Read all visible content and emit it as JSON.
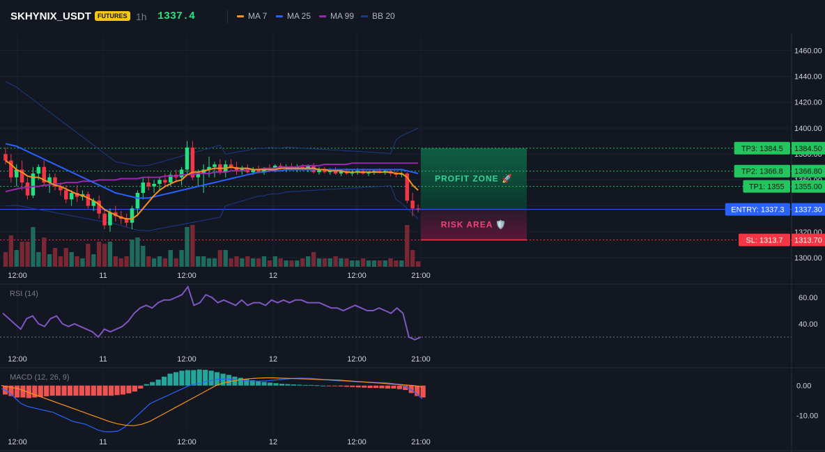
{
  "header": {
    "symbol": "SKHYNIX_USDT",
    "badge": "FUTURES",
    "interval": "1h",
    "price": "1337.4"
  },
  "legend": [
    {
      "label": "MA 7",
      "color": "#f7931a",
      "icon": "line-swatch"
    },
    {
      "label": "MA 25",
      "color": "#2962ff",
      "icon": "line-swatch"
    },
    {
      "label": "MA 99",
      "color": "#9c27b0",
      "icon": "line-swatch"
    },
    {
      "label": "BB 20",
      "color": "#1e3a8a",
      "icon": "line-swatch"
    }
  ],
  "chart_data": {
    "type": "candlestick",
    "symbol": "SKHYNIX_USDT",
    "interval": "1h",
    "price_axis": {
      "ticks": [
        "1460.00",
        "1440.00",
        "1420.00",
        "1400.00",
        "1380.00",
        "1360.00",
        "1340.00",
        "1320.00",
        "1300.00"
      ],
      "min": 1293,
      "max": 1472
    },
    "time_axis": [
      "12:00",
      "11",
      "12:00",
      "12",
      "12:00",
      "21:00"
    ],
    "candles": [
      [
        1380,
        1385,
        1372,
        1375
      ],
      [
        1375,
        1380,
        1358,
        1362
      ],
      [
        1362,
        1372,
        1355,
        1368
      ],
      [
        1368,
        1375,
        1352,
        1358
      ],
      [
        1358,
        1362,
        1345,
        1348
      ],
      [
        1348,
        1370,
        1346,
        1365
      ],
      [
        1365,
        1372,
        1360,
        1370
      ],
      [
        1370,
        1375,
        1355,
        1358
      ],
      [
        1358,
        1365,
        1350,
        1362
      ],
      [
        1362,
        1365,
        1352,
        1355
      ],
      [
        1355,
        1358,
        1348,
        1352
      ],
      [
        1352,
        1356,
        1342,
        1345
      ],
      [
        1345,
        1352,
        1340,
        1350
      ],
      [
        1350,
        1356,
        1343,
        1347
      ],
      [
        1347,
        1352,
        1344,
        1349
      ],
      [
        1349,
        1351,
        1338,
        1340
      ],
      [
        1340,
        1346,
        1336,
        1344
      ],
      [
        1344,
        1348,
        1330,
        1334
      ],
      [
        1334,
        1338,
        1322,
        1325
      ],
      [
        1325,
        1338,
        1320,
        1335
      ],
      [
        1335,
        1340,
        1328,
        1332
      ],
      [
        1332,
        1336,
        1326,
        1330
      ],
      [
        1330,
        1334,
        1324,
        1327
      ],
      [
        1327,
        1340,
        1322,
        1338
      ],
      [
        1338,
        1352,
        1332,
        1350
      ],
      [
        1350,
        1362,
        1345,
        1358
      ],
      [
        1358,
        1363,
        1352,
        1355
      ],
      [
        1355,
        1360,
        1350,
        1357
      ],
      [
        1357,
        1362,
        1352,
        1360
      ],
      [
        1360,
        1365,
        1355,
        1358
      ],
      [
        1358,
        1366,
        1355,
        1364
      ],
      [
        1364,
        1368,
        1358,
        1362
      ],
      [
        1362,
        1370,
        1356,
        1368
      ],
      [
        1368,
        1390,
        1365,
        1385
      ],
      [
        1385,
        1390,
        1360,
        1362
      ],
      [
        1362,
        1368,
        1355,
        1365
      ],
      [
        1365,
        1372,
        1350,
        1368
      ],
      [
        1368,
        1378,
        1362,
        1370
      ],
      [
        1370,
        1374,
        1362,
        1372
      ],
      [
        1372,
        1376,
        1364,
        1366
      ],
      [
        1366,
        1375,
        1362,
        1372
      ],
      [
        1372,
        1376,
        1368,
        1370
      ],
      [
        1370,
        1374,
        1364,
        1367
      ],
      [
        1367,
        1371,
        1364,
        1369
      ],
      [
        1369,
        1372,
        1365,
        1366
      ],
      [
        1366,
        1370,
        1364,
        1368
      ],
      [
        1368,
        1371,
        1365,
        1366
      ],
      [
        1366,
        1370,
        1364,
        1369
      ],
      [
        1369,
        1372,
        1366,
        1368
      ],
      [
        1368,
        1372,
        1366,
        1371
      ],
      [
        1371,
        1373,
        1367,
        1369
      ],
      [
        1369,
        1372,
        1366,
        1370
      ],
      [
        1370,
        1373,
        1367,
        1369
      ],
      [
        1369,
        1372,
        1366,
        1370
      ],
      [
        1370,
        1372,
        1367,
        1368
      ],
      [
        1368,
        1372,
        1366,
        1371
      ],
      [
        1371,
        1373,
        1365,
        1366
      ],
      [
        1366,
        1370,
        1364,
        1368
      ],
      [
        1368,
        1370,
        1365,
        1366
      ],
      [
        1366,
        1369,
        1364,
        1368
      ],
      [
        1368,
        1370,
        1364,
        1365
      ],
      [
        1365,
        1368,
        1363,
        1367
      ],
      [
        1367,
        1369,
        1364,
        1365
      ],
      [
        1365,
        1368,
        1363,
        1366
      ],
      [
        1366,
        1369,
        1364,
        1367
      ],
      [
        1367,
        1369,
        1364,
        1365
      ],
      [
        1365,
        1367,
        1363,
        1366
      ],
      [
        1366,
        1368,
        1364,
        1367
      ],
      [
        1367,
        1369,
        1365,
        1366
      ],
      [
        1366,
        1368,
        1364,
        1367
      ],
      [
        1367,
        1368,
        1363,
        1365
      ],
      [
        1365,
        1367,
        1362,
        1364
      ],
      [
        1364,
        1366,
        1362,
        1365
      ],
      [
        1365,
        1366,
        1342,
        1344
      ],
      [
        1344,
        1350,
        1332,
        1338
      ],
      [
        1338,
        1341,
        1335,
        1337.4
      ]
    ],
    "ma7": [
      1375,
      1372,
      1368,
      1366,
      1363,
      1362,
      1362,
      1360,
      1358,
      1356,
      1355,
      1353,
      1351,
      1349,
      1348,
      1346,
      1344,
      1341,
      1337,
      1335,
      1333,
      1331,
      1330,
      1330,
      1333,
      1338,
      1343,
      1348,
      1352,
      1355,
      1357,
      1359,
      1360,
      1364,
      1366,
      1366,
      1367,
      1368,
      1369,
      1369,
      1369,
      1370,
      1369,
      1369,
      1369,
      1368,
      1368,
      1368,
      1368,
      1368,
      1369,
      1369,
      1369,
      1369,
      1369,
      1369,
      1369,
      1368,
      1368,
      1367,
      1367,
      1367,
      1366,
      1366,
      1366,
      1366,
      1366,
      1366,
      1366,
      1366,
      1366,
      1365,
      1365,
      1362,
      1356,
      1352
    ],
    "ma25": [
      1388,
      1387,
      1386,
      1384,
      1382,
      1380,
      1378,
      1376,
      1374,
      1372,
      1370,
      1368,
      1366,
      1364,
      1362,
      1360,
      1358,
      1356,
      1354,
      1352,
      1350,
      1349,
      1348,
      1347,
      1346,
      1346,
      1346,
      1347,
      1348,
      1349,
      1350,
      1351,
      1352,
      1353,
      1354,
      1355,
      1356,
      1357,
      1358,
      1359,
      1360,
      1361,
      1362,
      1363,
      1364,
      1365,
      1366,
      1366,
      1367,
      1367,
      1367,
      1368,
      1368,
      1368,
      1368,
      1368,
      1368,
      1368,
      1368,
      1368,
      1368,
      1368,
      1368,
      1368,
      1368,
      1368,
      1368,
      1368,
      1368,
      1368,
      1368,
      1368,
      1368,
      1367,
      1366,
      1365
    ],
    "ma99": [
      1351,
      1352,
      1353,
      1354,
      1354,
      1355,
      1355,
      1356,
      1356,
      1357,
      1357,
      1358,
      1358,
      1358,
      1359,
      1359,
      1359,
      1360,
      1360,
      1360,
      1360,
      1361,
      1361,
      1361,
      1361,
      1362,
      1362,
      1362,
      1362,
      1363,
      1363,
      1363,
      1364,
      1364,
      1364,
      1365,
      1365,
      1365,
      1366,
      1366,
      1366,
      1367,
      1367,
      1367,
      1368,
      1368,
      1368,
      1369,
      1369,
      1369,
      1370,
      1370,
      1370,
      1370,
      1371,
      1371,
      1371,
      1371,
      1372,
      1372,
      1372,
      1372,
      1372,
      1373,
      1373,
      1373,
      1373,
      1373,
      1373,
      1373,
      1373,
      1373,
      1373,
      1373,
      1373,
      1373
    ],
    "levels": [
      {
        "label": "TP3: 1384.5",
        "price": "1384.50",
        "value": 1384.5,
        "color": "#22c55e"
      },
      {
        "label": "TP2: 1366.8",
        "price": "1366.80",
        "value": 1366.8,
        "color": "#22c55e"
      },
      {
        "label": "TP1: 1355",
        "price": "1355.00",
        "value": 1355.0,
        "color": "#22c55e"
      },
      {
        "label": "ENTRY: 1337.3",
        "price": "1337.30",
        "value": 1337.3,
        "color": "#2962ff"
      },
      {
        "label": "SL: 1313.7",
        "price": "1313.70",
        "value": 1313.7,
        "color": "#f23645"
      }
    ],
    "zones": {
      "profit": "PROFIT ZONE 🚀",
      "risk": "RISK AREA 🛡️"
    },
    "rsi": {
      "title": "RSI (14)",
      "ticks": [
        "60.00",
        "40.00"
      ],
      "min": 20,
      "max": 70,
      "values": [
        48,
        44,
        40,
        36,
        44,
        46,
        40,
        38,
        44,
        46,
        40,
        38,
        40,
        38,
        36,
        34,
        30,
        36,
        34,
        36,
        38,
        42,
        48,
        52,
        54,
        52,
        56,
        58,
        58,
        60,
        62,
        68,
        54,
        56,
        62,
        60,
        56,
        58,
        56,
        54,
        58,
        54,
        56,
        56,
        54,
        58,
        56,
        58,
        56,
        58,
        58,
        56,
        56,
        56,
        54,
        52,
        52,
        50,
        52,
        54,
        52,
        50,
        50,
        52,
        50,
        48,
        52,
        48,
        30,
        28,
        30
      ]
    },
    "macd": {
      "title": "MACD (12, 26, 9)",
      "ticks": [
        "0.00",
        "-10.00"
      ],
      "min": -16,
      "max": 6,
      "hist": [
        -3,
        -3.5,
        -4,
        -4,
        -4.2,
        -4,
        -3.8,
        -3.6,
        -3.4,
        -3.4,
        -3.4,
        -3.4,
        -3.4,
        -3.4,
        -3.4,
        -3.4,
        -3.4,
        -3.4,
        -3.4,
        -3.2,
        -3,
        -2.6,
        -2,
        -1,
        0.5,
        1.2,
        2,
        3,
        4,
        4.5,
        5,
        5.2,
        5.2,
        5.4,
        5.3,
        5,
        4.5,
        4,
        3.6,
        3,
        2.6,
        2.2,
        1.8,
        1.4,
        1.2,
        1,
        0.8,
        0.6,
        0.5,
        0.4,
        0.3,
        0.2,
        0.2,
        0.1,
        0,
        -0.1,
        -0.2,
        -0.3,
        -0.4,
        -0.5,
        -0.6,
        -0.7,
        -0.8,
        -0.8,
        -0.9,
        -1,
        -1,
        -1.2,
        -1.5,
        -2.5,
        -3.5,
        -4
      ],
      "macd": [
        -1,
        -2,
        -4,
        -6,
        -7,
        -7.5,
        -8,
        -8.5,
        -9,
        -10,
        -11,
        -12,
        -12.5,
        -13,
        -14,
        -15,
        -15.5,
        -15.5,
        -15.3,
        -14,
        -12,
        -10,
        -8,
        -6,
        -5,
        -4,
        -3,
        -2,
        -1,
        0,
        0.5,
        1,
        1.5,
        2,
        2.2,
        2.2,
        2,
        1.8,
        1.6,
        1.5,
        1.5,
        1.6,
        1.8,
        2,
        2.2,
        2.4,
        2.5,
        2.5,
        2.4,
        2.2,
        2,
        1.8,
        1.6,
        1.5,
        1.4,
        1.3,
        1.2,
        1.1,
        1,
        1,
        0.8,
        0.5,
        0,
        -1,
        -2.5,
        -4.5
      ],
      "signal": [
        0,
        -0.5,
        -1,
        -2,
        -3,
        -4,
        -5,
        -6,
        -7,
        -8,
        -9,
        -10,
        -11,
        -12,
        -12.8,
        -13.3,
        -13.5,
        -13,
        -12,
        -10.5,
        -9,
        -7.5,
        -6,
        -4.5,
        -3,
        -1.5,
        0,
        1,
        1.5,
        2,
        2.3,
        2.5,
        2.6,
        2.6,
        2.5,
        2.4,
        2.3,
        2.2,
        2.1,
        2,
        1.9,
        1.8,
        1.6,
        1.4,
        1.2,
        1,
        0.8,
        0.6,
        0.4,
        0.2,
        0,
        -0.5
      ]
    }
  }
}
